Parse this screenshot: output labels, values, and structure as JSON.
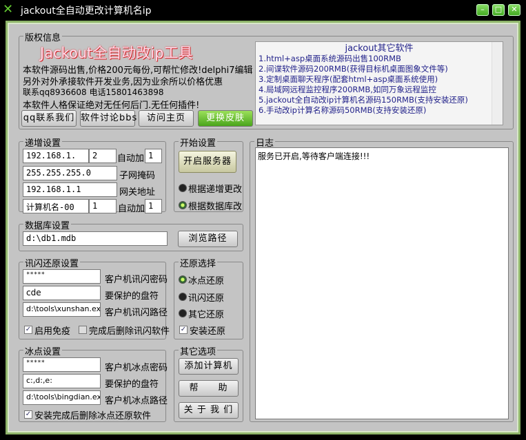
{
  "window": {
    "title": "jackout全自动更改计算机名ip",
    "min": "–",
    "max": "□",
    "close": "✕"
  },
  "copyright": {
    "label": "版权信息",
    "banner": "Jackout全自动改ip工具",
    "lines": [
      "本软件源码出售,价格200元每份,可帮忙修改!delphi7编辑",
      "另外对外承接软件开发业务,因为业余所以价格优惠",
      "联系qq8936608 电话15801463898",
      "本软件人格保证绝对无任何后门.无任何插件!"
    ],
    "buttons": [
      "qq联系我们",
      "软件讨论bbs",
      "访问主页",
      "更换皮肤"
    ]
  },
  "other_software": {
    "title": "jackout其它软件",
    "items": [
      "1.html+asp桌面系统源码出售100RMB",
      "2.间谍软件源码200RMB(获得目标机桌面图象文件等)",
      "3.定制桌面聊天程序(配套html+asp桌面系统使用)",
      "4.局域网远程监控程序200RMB,如同万象远程监控",
      "5.jackout全自动改ip计算机名源码150RMB(支持安装还原)",
      "6.手动改ip计算名称源码50RMB(支持安装还原)"
    ]
  },
  "increment": {
    "label": "递增设置",
    "ip_prefix": "192.168.1.",
    "ip_start": "2",
    "auto_add_label": "自动加",
    "ip_step": "1",
    "mask": "255.255.255.0",
    "mask_label": "子网掩码",
    "gateway": "192.168.1.1",
    "gateway_label": "网关地址",
    "name_prefix": "计算机名-00",
    "name_start": "1",
    "name_step": "1"
  },
  "start": {
    "label": "开始设置",
    "server_button": "开启服务器",
    "radio1": "根据递增更改",
    "radio2": "根据数据库改"
  },
  "database": {
    "label": "数据库设置",
    "path": "d:\\db1.mdb",
    "browse": "浏览路径"
  },
  "xunshan": {
    "label": "讯闪还原设置",
    "password": "*****",
    "password_label": "客户机讯闪密码",
    "drives": "cde",
    "drives_label": "要保护的盘符",
    "path": "d:\\tools\\xunshan.exe",
    "path_label": "客户机讯闪路径",
    "chk1": "启用免疫",
    "chk2": "完成后删除讯闪软件"
  },
  "restore": {
    "label": "还原选择",
    "r1": "冰点还原",
    "r2": "讯闪还原",
    "r3": "其它还原",
    "install": "安装还原"
  },
  "bingdian": {
    "label": "冰点设置",
    "password": "*****",
    "password_label": "客户机冰点密码",
    "drives": "c:,d:,e:",
    "drives_label": "要保护的盘符",
    "path": "d:\\tools\\bingdian.exe",
    "path_label": "客户机冰点路径",
    "chk": "安装完成后删除冰点还原软件"
  },
  "other": {
    "label": "其它选项",
    "add": "添加计算机",
    "help": "帮　　助",
    "about": "关 于 我 们"
  },
  "log": {
    "label": "日志",
    "text": "服务已开启,等待客户端连接!!!"
  }
}
